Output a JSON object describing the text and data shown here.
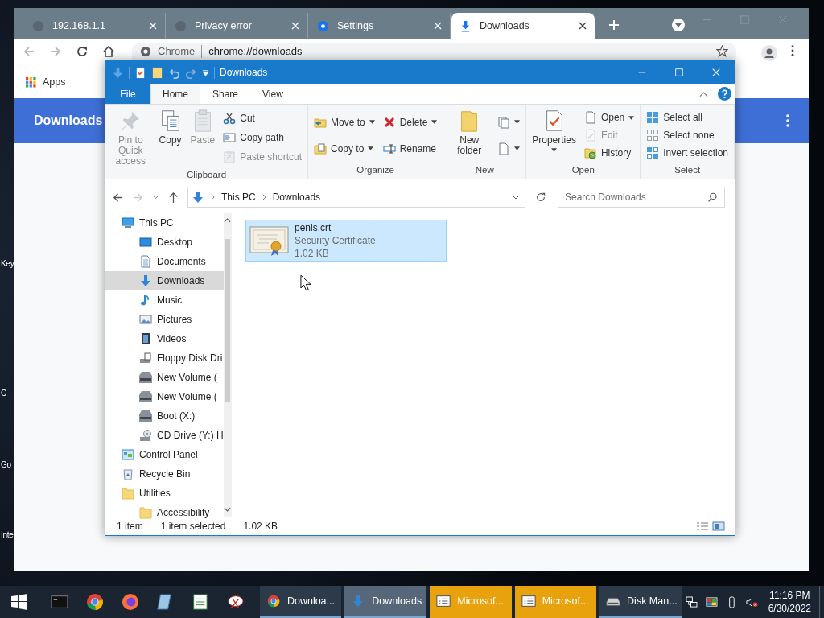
{
  "desktop": {
    "icon_labels": [
      "Key",
      "C",
      "Go",
      "Inte"
    ]
  },
  "browser": {
    "tabs": [
      {
        "title": "192.168.1.1",
        "selected": false
      },
      {
        "title": "Privacy error",
        "selected": false
      },
      {
        "title": "Settings",
        "selected": false
      },
      {
        "title": "Downloads",
        "selected": true
      }
    ],
    "omnibox": {
      "origin": "Chrome",
      "url": "chrome://downloads"
    },
    "bookmarks": [
      "Apps"
    ],
    "page": {
      "title": "Downloads"
    }
  },
  "explorer": {
    "title": "Downloads",
    "ribbon_tabs": [
      {
        "label": "File",
        "kind": "file",
        "selected": false
      },
      {
        "label": "Home",
        "kind": "tab",
        "selected": true
      },
      {
        "label": "Share",
        "kind": "tab",
        "selected": false
      },
      {
        "label": "View",
        "kind": "tab",
        "selected": false
      }
    ],
    "groups": [
      {
        "label": "Clipboard",
        "columns": [
          [
            {
              "kind": "large",
              "label": "Pin to Quick access",
              "disabled": true,
              "dropdown": false
            }
          ],
          [
            {
              "kind": "large",
              "label": "Copy",
              "disabled": false,
              "dropdown": false
            }
          ],
          [
            {
              "kind": "large",
              "label": "Paste",
              "disabled": true,
              "dropdown": false
            }
          ],
          [
            {
              "kind": "small",
              "label": "Cut",
              "disabled": false,
              "dropdown": false
            },
            {
              "kind": "small",
              "label": "Copy path",
              "disabled": false,
              "dropdown": false
            },
            {
              "kind": "small",
              "label": "Paste shortcut",
              "disabled": true,
              "dropdown": false
            }
          ]
        ]
      },
      {
        "label": "Organize",
        "columns": [
          [
            {
              "kind": "small",
              "label": "Move to",
              "disabled": false,
              "dropdown": true
            },
            {
              "kind": "small",
              "label": "Copy to",
              "disabled": false,
              "dropdown": true
            }
          ],
          [
            {
              "kind": "small",
              "label": "Delete",
              "disabled": false,
              "dropdown": true
            },
            {
              "kind": "small",
              "label": "Rename",
              "disabled": false,
              "dropdown": false
            }
          ]
        ]
      },
      {
        "label": "New",
        "columns": [
          [
            {
              "kind": "large",
              "label": "New folder",
              "disabled": false,
              "dropdown": false
            }
          ],
          [
            {
              "kind": "icon",
              "disabled": false,
              "dropdown": true
            },
            {
              "kind": "icon",
              "disabled": false,
              "dropdown": true
            }
          ]
        ]
      },
      {
        "label": "Open",
        "columns": [
          [
            {
              "kind": "large",
              "label": "Properties",
              "disabled": false,
              "dropdown": true
            }
          ],
          [
            {
              "kind": "small",
              "label": "Open",
              "disabled": false,
              "dropdown": true
            },
            {
              "kind": "small",
              "label": "Edit",
              "disabled": true,
              "dropdown": false
            },
            {
              "kind": "small",
              "label": "History",
              "disabled": false,
              "dropdown": false
            }
          ]
        ]
      },
      {
        "label": "Select",
        "columns": [
          [
            {
              "kind": "small",
              "label": "Select all",
              "disabled": false,
              "dropdown": false
            },
            {
              "kind": "small",
              "label": "Select none",
              "disabled": false,
              "dropdown": false
            },
            {
              "kind": "small",
              "label": "Invert selection",
              "disabled": false,
              "dropdown": false
            }
          ]
        ]
      }
    ],
    "breadcrumb": [
      "This PC",
      "Downloads"
    ],
    "search": {
      "placeholder": "Search Downloads"
    },
    "nav": [
      {
        "label": "This PC",
        "selected": false,
        "children": [
          {
            "label": "Desktop",
            "selected": false
          },
          {
            "label": "Documents",
            "selected": false
          },
          {
            "label": "Downloads",
            "selected": true
          },
          {
            "label": "Music",
            "selected": false
          },
          {
            "label": "Pictures",
            "selected": false
          },
          {
            "label": "Videos",
            "selected": false
          },
          {
            "label": "Floppy Disk Dri",
            "selected": false
          },
          {
            "label": "New Volume (",
            "selected": false
          },
          {
            "label": "New Volume (",
            "selected": false
          },
          {
            "label": "Boot (X:)",
            "selected": false
          },
          {
            "label": "CD Drive (Y:) H",
            "selected": false
          }
        ]
      },
      {
        "label": "Control Panel",
        "selected": false
      },
      {
        "label": "Recycle Bin",
        "selected": false
      },
      {
        "label": "Utilities",
        "selected": false,
        "children": [
          {
            "label": "Accessibility",
            "selected": false
          }
        ]
      }
    ],
    "files": [
      {
        "name": "penis.crt",
        "type": "Security Certificate",
        "size": "1.02 KB",
        "selected": true
      }
    ],
    "status": {
      "item_count": "1 item",
      "selection": "1 item selected",
      "selection_size": "1.02 KB"
    }
  },
  "taskbar": {
    "windows": [
      {
        "label": "Downloa...",
        "selected": false,
        "flashing": false
      },
      {
        "label": "Downloads",
        "selected": true,
        "flashing": false
      },
      {
        "label": "Microsof...",
        "selected": false,
        "flashing": true
      },
      {
        "label": "Microsof...",
        "selected": false,
        "flashing": true
      },
      {
        "label": "Disk Man...",
        "selected": false,
        "flashing": false
      }
    ],
    "clock": {
      "time": "11:16 PM",
      "date": "6/30/2022"
    }
  }
}
